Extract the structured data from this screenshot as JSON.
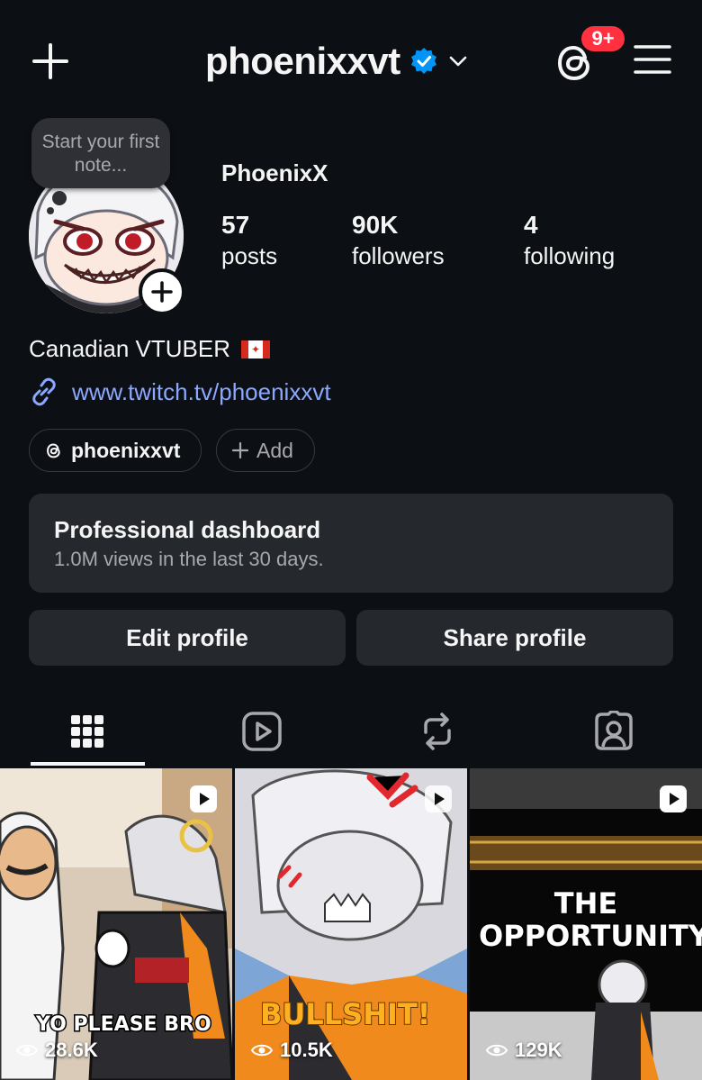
{
  "header": {
    "username": "phoenixxvt",
    "notification_badge": "9+"
  },
  "profile": {
    "note_text": "Start your first note...",
    "display_name": "PhoenixX",
    "stats": [
      {
        "value": "57",
        "label": "posts"
      },
      {
        "value": "90K",
        "label": "followers"
      },
      {
        "value": "4",
        "label": "following"
      }
    ],
    "bio": "Canadian VTUBER",
    "link": "www.twitch.tv/phoenixxvt",
    "threads_chip": "phoenixxvt",
    "add_chip": "Add"
  },
  "dashboard": {
    "title": "Professional dashboard",
    "subtitle": "1.0M views in the last 30 days."
  },
  "actions": {
    "edit": "Edit profile",
    "share": "Share profile"
  },
  "tabs": [
    "grid-icon",
    "reels-icon",
    "reposts-icon",
    "tagged-icon"
  ],
  "posts": [
    {
      "caption": "YO PLEASE BRO",
      "views": "28.6K"
    },
    {
      "caption": "BULLSHIT!",
      "views": "10.5K"
    },
    {
      "caption": "THE OPPORTUNITY",
      "views": "129K"
    }
  ],
  "colors": {
    "background": "#0c1014",
    "card": "#25292e",
    "link": "#8ba7ff",
    "badge": "#ff3040",
    "verified": "#0095f6"
  }
}
